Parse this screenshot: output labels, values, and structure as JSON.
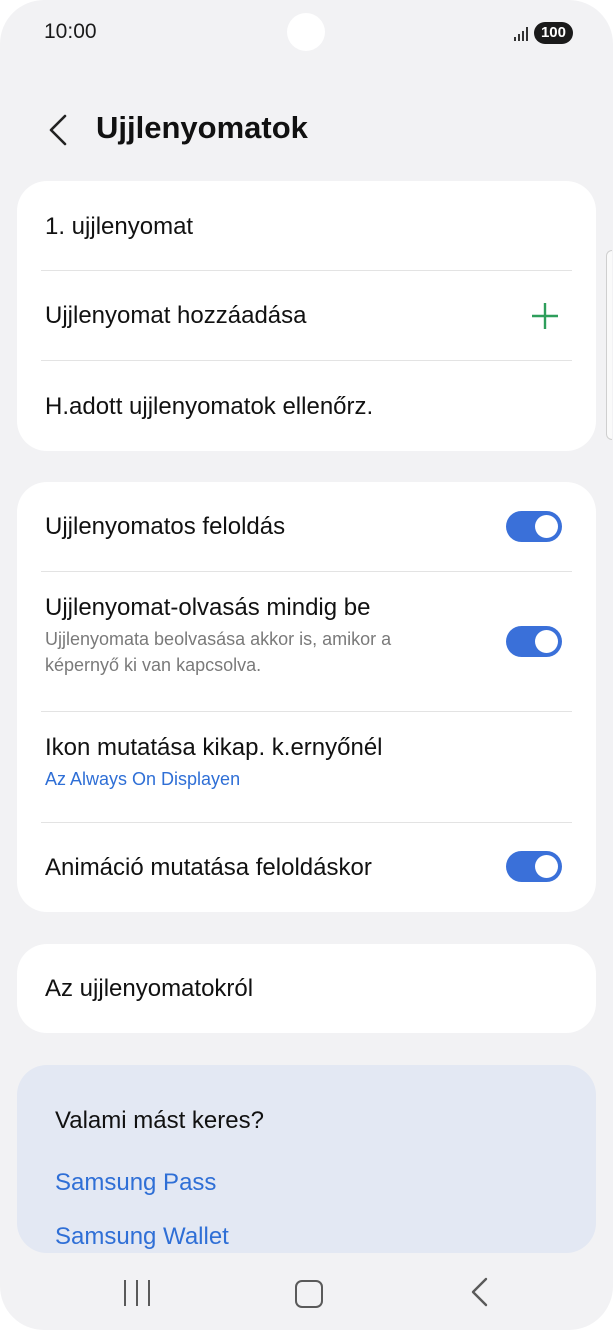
{
  "status": {
    "time": "10:00",
    "battery": "100"
  },
  "header": {
    "title": "Ujjlenyomatok"
  },
  "fingerprints": {
    "item1": "1. ujjlenyomat",
    "add": "Ujjlenyomat hozzáadása",
    "check": "H.adott ujjlenyomatok ellenőrz."
  },
  "settings": {
    "unlock": {
      "title": "Ujjlenyomatos feloldás",
      "enabled": true
    },
    "always_on": {
      "title": "Ujjlenyomat-olvasás mindig be",
      "subtitle_line1": "Ujjlenyomata beolvasása akkor is, amikor a",
      "subtitle_line2": "képernyő ki van kapcsolva.",
      "enabled": true
    },
    "icon": {
      "title": "Ikon mutatása kikap. k.ernyőnél",
      "subtitle": "Az Always On Displayen"
    },
    "animation": {
      "title": "Animáció mutatása feloldáskor",
      "enabled": true
    }
  },
  "about": {
    "title": "Az ujjlenyomatokról"
  },
  "suggestions": {
    "title": "Valami mást keres?",
    "links": [
      "Samsung Pass",
      "Samsung Wallet"
    ]
  },
  "colors": {
    "accent": "#3a70d9",
    "link": "#2f6fd6",
    "plus": "#2e9e5b"
  }
}
